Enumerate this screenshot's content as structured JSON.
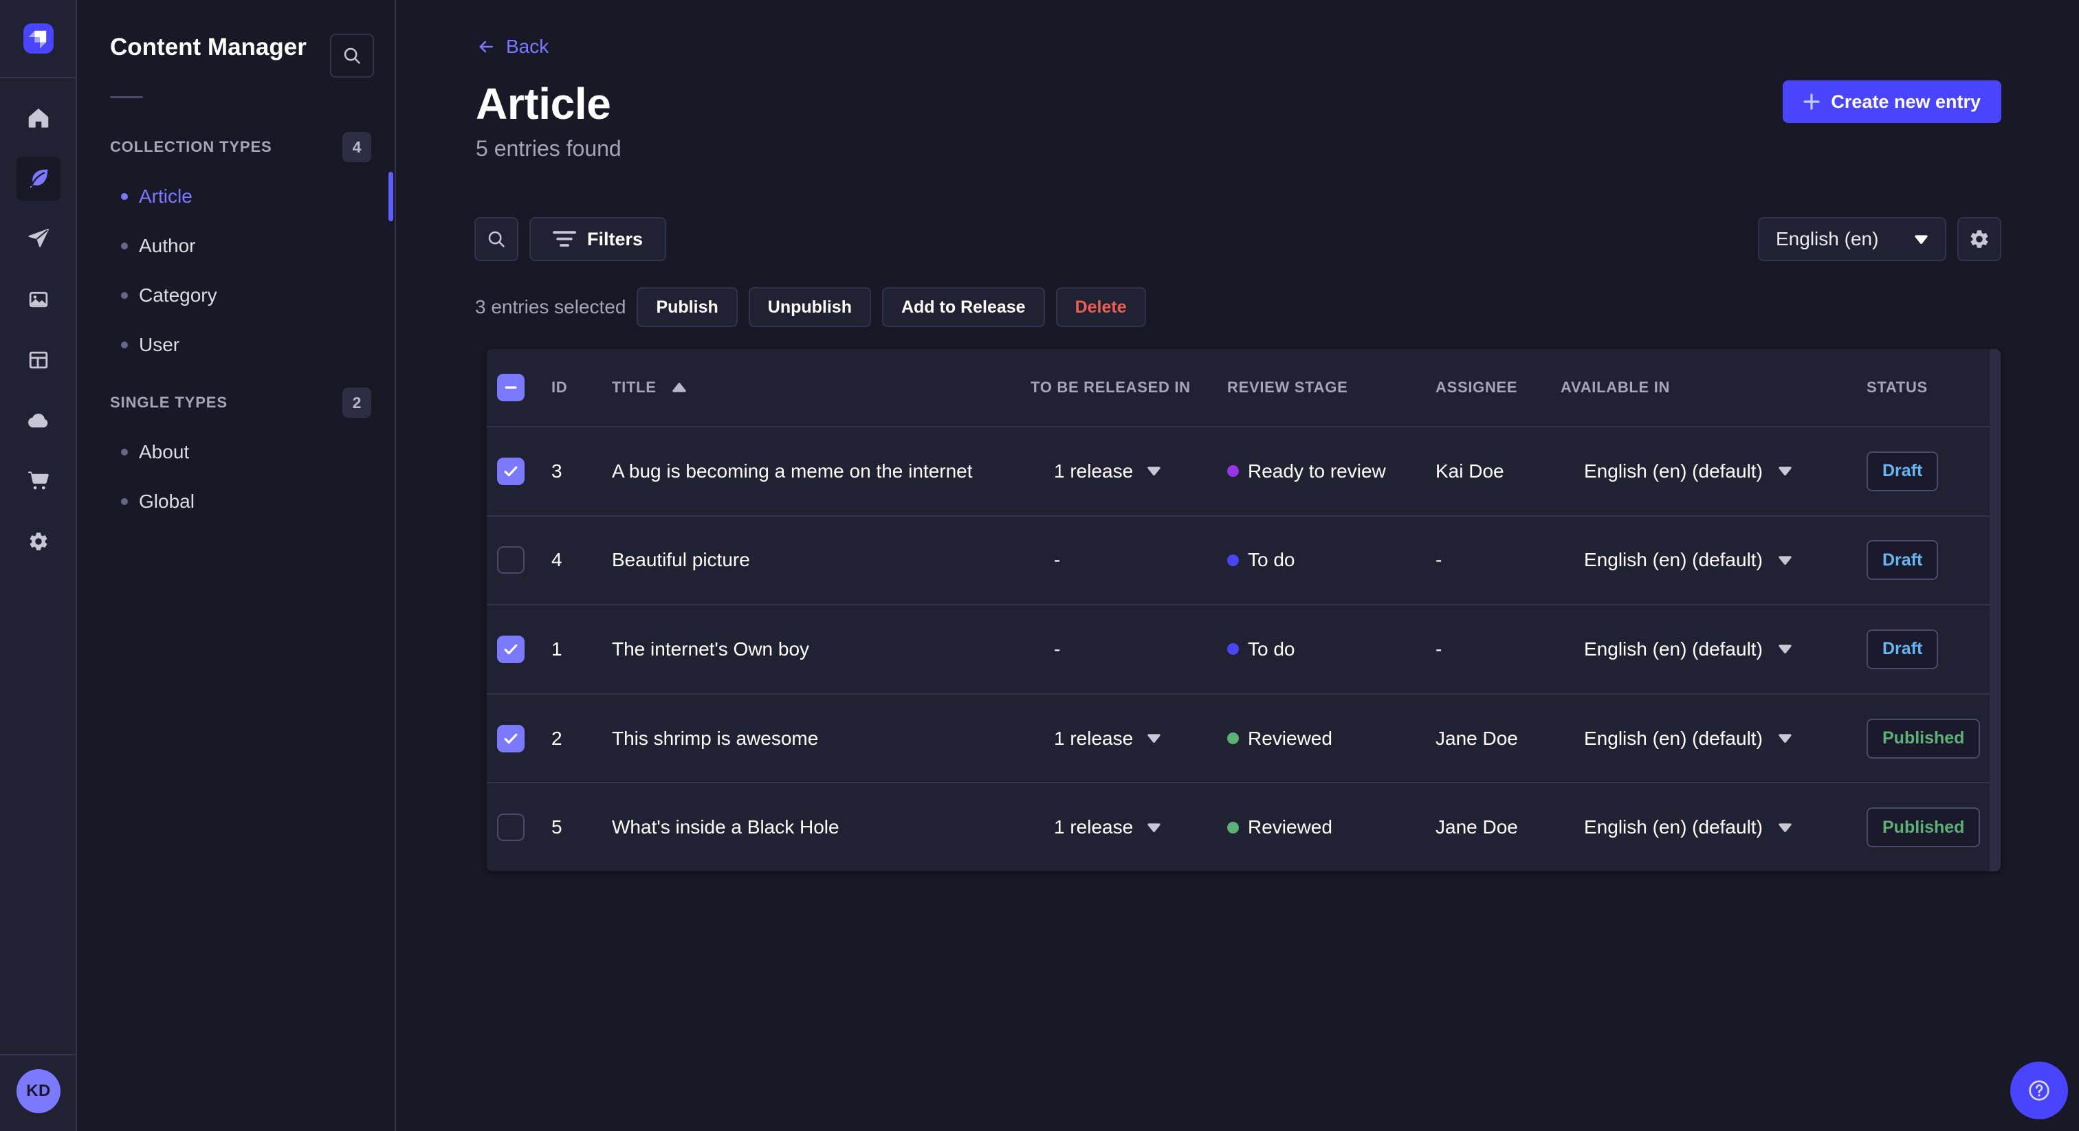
{
  "rail": {
    "logo": "strapi-logo",
    "items": [
      {
        "icon": "home-icon",
        "active": false
      },
      {
        "icon": "feather-icon",
        "active": true
      },
      {
        "icon": "send-icon",
        "active": false
      },
      {
        "icon": "images-icon",
        "active": false
      },
      {
        "icon": "layout-icon",
        "active": false
      },
      {
        "icon": "cloud-icon",
        "active": false
      },
      {
        "icon": "cart-icon",
        "active": false
      },
      {
        "icon": "gear-icon",
        "active": false
      }
    ],
    "avatar_initials": "KD"
  },
  "sidebar": {
    "title": "Content Manager",
    "search_icon": "search-icon",
    "sections": [
      {
        "label": "COLLECTION TYPES",
        "badge": "4",
        "items": [
          {
            "label": "Article",
            "active": true
          },
          {
            "label": "Author",
            "active": false
          },
          {
            "label": "Category",
            "active": false
          },
          {
            "label": "User",
            "active": false
          }
        ]
      },
      {
        "label": "SINGLE TYPES",
        "badge": "2",
        "items": [
          {
            "label": "About",
            "active": false
          },
          {
            "label": "Global",
            "active": false
          }
        ]
      }
    ]
  },
  "header": {
    "back_label": "Back",
    "title": "Article",
    "subtitle": "5 entries found",
    "create_label": "Create new entry"
  },
  "toolbar": {
    "filters_label": "Filters",
    "language_value": "English (en)",
    "selected_text": "3 entries selected",
    "actions": [
      {
        "label": "Publish",
        "variant": "default"
      },
      {
        "label": "Unpublish",
        "variant": "default"
      },
      {
        "label": "Add to Release",
        "variant": "default"
      },
      {
        "label": "Delete",
        "variant": "danger"
      }
    ]
  },
  "table": {
    "columns": [
      "ID",
      "TITLE",
      "TO BE RELEASED IN",
      "REVIEW STAGE",
      "ASSIGNEE",
      "AVAILABLE IN",
      "STATUS"
    ],
    "sorted_column": "TITLE",
    "rows": [
      {
        "checked": true,
        "id": "3",
        "title": "A bug is becoming a meme on the internet",
        "release": "1 release",
        "stage": "Ready to review",
        "stage_color": "#9736e8",
        "assignee": "Kai Doe",
        "locale": "English (en) (default)",
        "status": "Draft"
      },
      {
        "checked": false,
        "id": "4",
        "title": "Beautiful picture",
        "release": "-",
        "stage": "To do",
        "stage_color": "#4945ff",
        "assignee": "-",
        "locale": "English (en) (default)",
        "status": "Draft"
      },
      {
        "checked": true,
        "id": "1",
        "title": "The internet's Own boy",
        "release": "-",
        "stage": "To do",
        "stage_color": "#4945ff",
        "assignee": "-",
        "locale": "English (en) (default)",
        "status": "Draft"
      },
      {
        "checked": true,
        "id": "2",
        "title": "This shrimp is awesome",
        "release": "1 release",
        "stage": "Reviewed",
        "stage_color": "#5cb176",
        "assignee": "Jane Doe",
        "locale": "English (en) (default)",
        "status": "Published"
      },
      {
        "checked": false,
        "id": "5",
        "title": "What's inside a Black Hole",
        "release": "1 release",
        "stage": "Reviewed",
        "stage_color": "#5cb176",
        "assignee": "Jane Doe",
        "locale": "English (en) (default)",
        "status": "Published"
      }
    ],
    "header_checkbox": "indeterminate"
  },
  "colors": {
    "background": "#181826",
    "surface": "#212134",
    "primary": "#4945ff",
    "primary_light": "#7b79ff",
    "draft": "#66b7f1",
    "published": "#5cb176",
    "danger": "#ee5e52",
    "stage_ready_to_review": "#9736e8",
    "stage_to_do": "#4945ff",
    "stage_reviewed": "#5cb176"
  },
  "help_icon": "question-icon"
}
